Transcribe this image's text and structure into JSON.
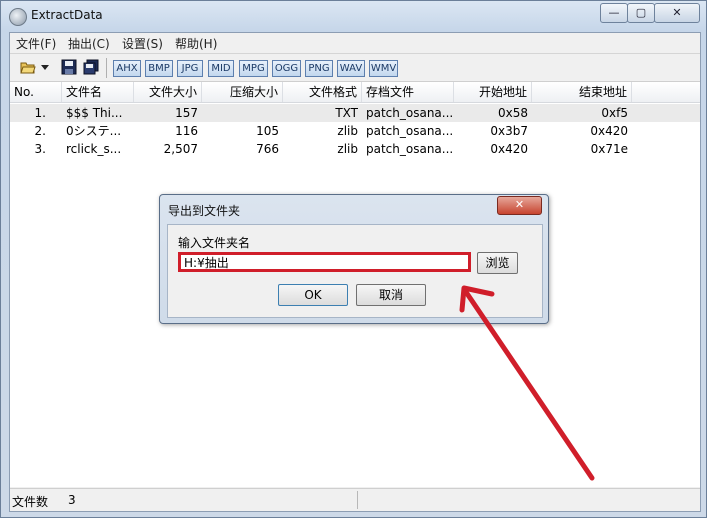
{
  "window": {
    "title": "ExtractData",
    "min_glyph": "—",
    "max_glyph": "▢",
    "close_glyph": "✕"
  },
  "menu": {
    "items": [
      "文件(F)",
      "抽出(C)",
      "设置(S)",
      "帮助(H)"
    ]
  },
  "toolbar": {
    "formats": [
      "AHX",
      "BMP",
      "JPG",
      "MID",
      "MPG",
      "OGG",
      "PNG",
      "WAV",
      "WMV"
    ]
  },
  "list": {
    "columns": [
      "No.",
      "文件名",
      "文件大小",
      "压缩大小",
      "文件格式",
      "存档文件",
      "开始地址",
      "结束地址"
    ],
    "rows": [
      {
        "no": "1.",
        "name": "$$$ Thi...",
        "size": "157",
        "csize": "",
        "fmt": "TXT",
        "archive": "patch_osana...",
        "start": "0x58",
        "end": "0xf5"
      },
      {
        "no": "2.",
        "name": "0システ...",
        "size": "116",
        "csize": "105",
        "fmt": "zlib",
        "archive": "patch_osana...",
        "start": "0x3b7",
        "end": "0x420"
      },
      {
        "no": "3.",
        "name": "rclick_s...",
        "size": "2,507",
        "csize": "766",
        "fmt": "zlib",
        "archive": "patch_osana...",
        "start": "0x420",
        "end": "0x71e"
      }
    ]
  },
  "status": {
    "label": "文件数",
    "value": "3"
  },
  "dialog": {
    "title": "导出到文件夹",
    "close_glyph": "✕",
    "prompt": "输入文件夹名",
    "input_value": "H:¥抽出",
    "browse": "浏览",
    "ok": "OK",
    "cancel": "取消"
  },
  "colors": {
    "annotation": "#d01e2a",
    "selected_row": "#eaeaea"
  }
}
